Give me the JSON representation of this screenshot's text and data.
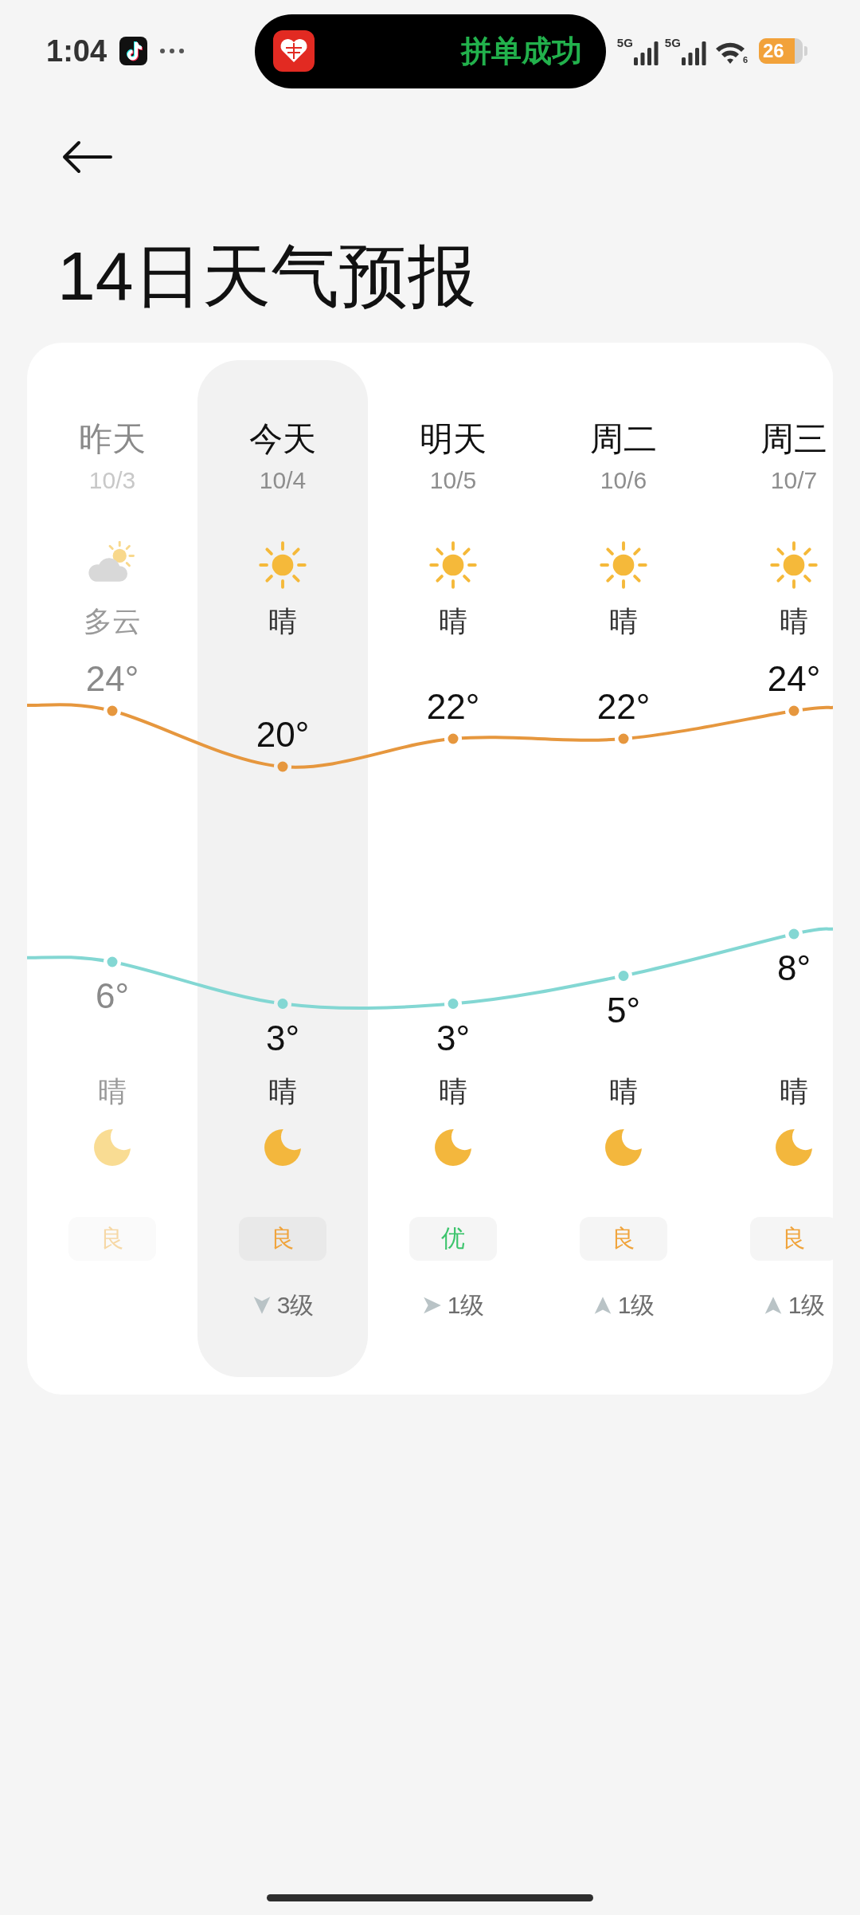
{
  "status_bar": {
    "time": "1:04",
    "notification": {
      "text": "拼单成功"
    },
    "network": [
      {
        "label": "5G"
      },
      {
        "label": "5G"
      }
    ],
    "wifi": {
      "label": "6"
    },
    "battery": {
      "label": "26"
    }
  },
  "header": {
    "title": "14日天气预报"
  },
  "forecast": {
    "days": [
      {
        "name": "昨天",
        "date": "10/3",
        "past": true,
        "selected": false,
        "day": {
          "kind": "partly_cloudy",
          "condition": "多云"
        },
        "high": "24°",
        "low": "6°",
        "night": {
          "kind": "moon",
          "condition": "晴"
        },
        "aqi": {
          "label": "良",
          "color": "#f6d8a6"
        }
      },
      {
        "name": "今天",
        "date": "10/4",
        "past": false,
        "selected": true,
        "day": {
          "kind": "sunny",
          "condition": "晴"
        },
        "high": "20°",
        "low": "3°",
        "night": {
          "kind": "moon",
          "condition": "晴"
        },
        "aqi": {
          "label": "良",
          "color": "#f0a43c"
        },
        "wind": {
          "kind": "down",
          "label": "3级"
        }
      },
      {
        "name": "明天",
        "date": "10/5",
        "past": false,
        "selected": false,
        "day": {
          "kind": "sunny",
          "condition": "晴"
        },
        "high": "22°",
        "low": "3°",
        "night": {
          "kind": "moon",
          "condition": "晴"
        },
        "aqi": {
          "label": "优",
          "color": "#3cc46c"
        },
        "wind": {
          "kind": "right",
          "label": "1级"
        }
      },
      {
        "name": "周二",
        "date": "10/6",
        "past": false,
        "selected": false,
        "day": {
          "kind": "sunny",
          "condition": "晴"
        },
        "high": "22°",
        "low": "5°",
        "night": {
          "kind": "moon",
          "condition": "晴"
        },
        "aqi": {
          "label": "良",
          "color": "#f0a43c"
        },
        "wind": {
          "kind": "up",
          "label": "1级"
        }
      },
      {
        "name": "周三",
        "date": "10/7",
        "past": false,
        "selected": false,
        "day": {
          "kind": "sunny",
          "condition": "晴"
        },
        "high": "24°",
        "low": "8°",
        "night": {
          "kind": "moon",
          "condition": "晴"
        },
        "aqi": {
          "label": "良",
          "color": "#f0a43c"
        },
        "wind": {
          "kind": "up",
          "label": "1级"
        }
      }
    ]
  }
}
